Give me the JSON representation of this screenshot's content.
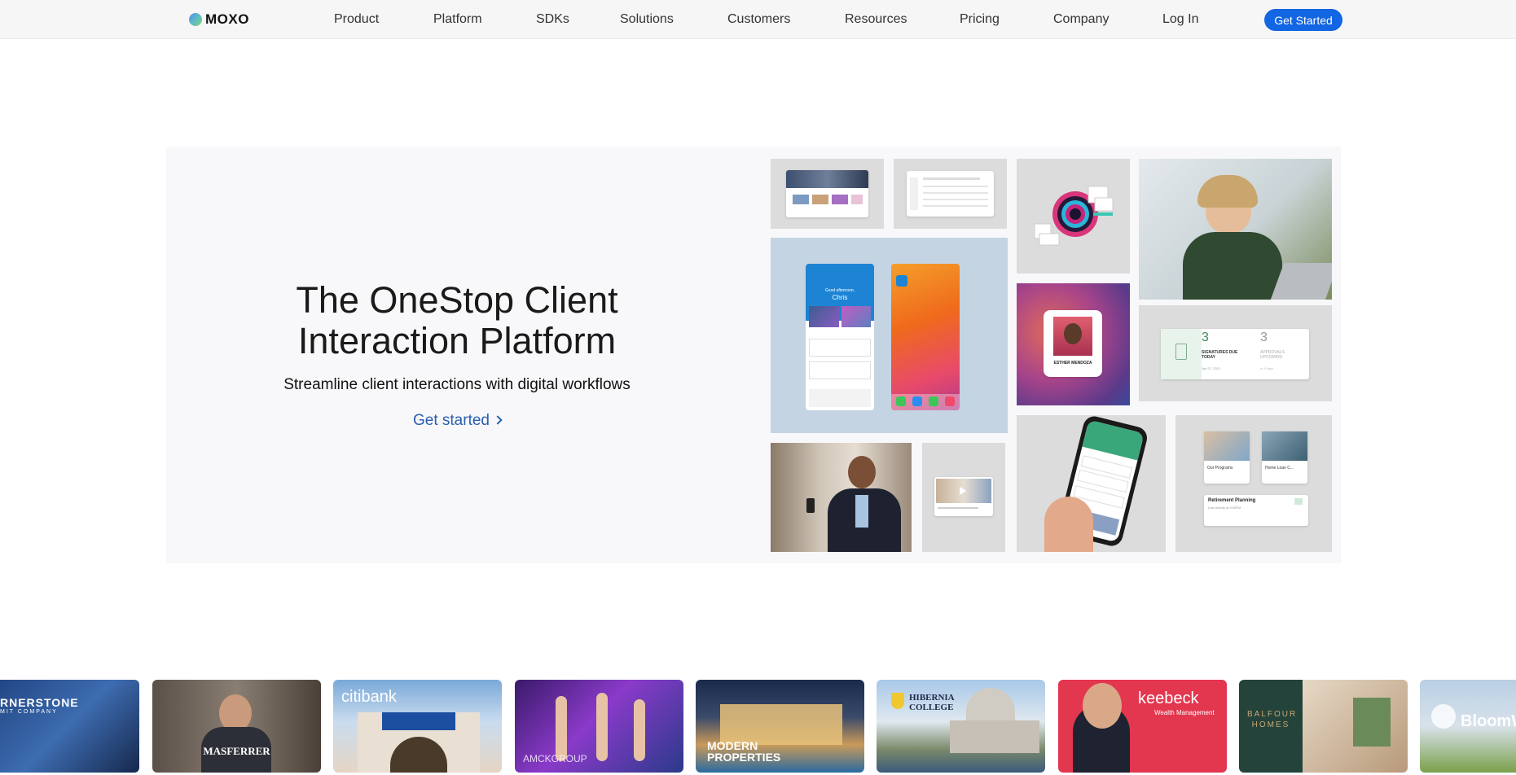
{
  "nav": {
    "brand": "MOXO",
    "items": [
      "Product",
      "Platform",
      "SDKs",
      "Solutions",
      "Customers",
      "Resources",
      "Pricing",
      "Company",
      "Log In"
    ],
    "cta": "Get Started"
  },
  "hero": {
    "title_line1": "The OneStop Client",
    "title_line2": "Interaction Platform",
    "subtitle": "Streamline client interactions with digital workflows",
    "link": "Get started",
    "mockups": {
      "phone_greeting": "Good afternoon,",
      "phone_name": "Chris",
      "contact_name": "ESTHER MENDOZA",
      "stat1_value": "3",
      "stat1_label": "SIGNATURES DUE TODAY",
      "stat1_date": "Jan 27, 2021",
      "stat2_value": "3",
      "stat2_label": "APPROVALS UPCOMING",
      "stat2_sub": "in 3 days",
      "program1": "Our Programs",
      "program2": "Home Loan C...",
      "card_title": "Retirement Planning",
      "card_sub": "Last activity at 9:30PM"
    }
  },
  "clients": [
    {
      "label": "RNERSTONE",
      "sub": "MIT COMPANY"
    },
    {
      "label": "MASFERRER",
      "sub": ""
    },
    {
      "label": "citibank",
      "sub": ""
    },
    {
      "label": "AMCKGROUP",
      "sub": ""
    },
    {
      "label": "MODERN PROPERTIES",
      "sub": ""
    },
    {
      "label": "HIBERNIA COLLEGE",
      "sub": ""
    },
    {
      "label": "keebeck",
      "sub": "Wealth Management"
    },
    {
      "label": "BALFOUR HOMES",
      "sub": ""
    },
    {
      "label": "BloomW",
      "sub": ""
    }
  ],
  "colors": {
    "accent": "#1265e3",
    "link": "#2a5fb0",
    "keebeck": "#e3364f"
  }
}
